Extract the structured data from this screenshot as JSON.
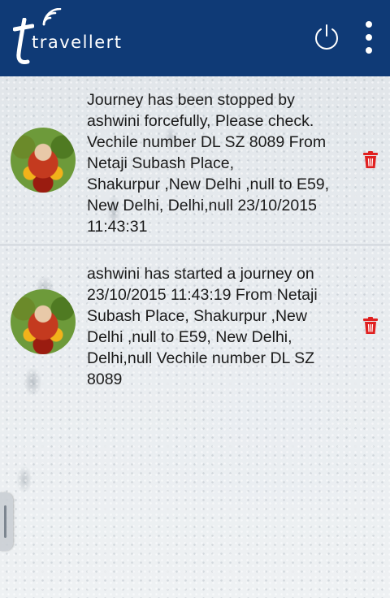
{
  "app": {
    "title": "travellert",
    "logo_icon": "travellert-logo-icon",
    "accent_color": "#0f3a76"
  },
  "toolbar": {
    "power_icon": "power-icon",
    "overflow_icon": "more-vertical-icon"
  },
  "notifications": [
    {
      "message": "Journey has been stopped by\nashwini forcefully, Please check.\nVechile number DL SZ 8089 From\nNetaji Subash Place,\nShakurpur ,New Delhi ,null to E59,\nNew Delhi, Delhi,null 23/10/2015\n11:43:31",
      "avatar_icon": "profile-avatar",
      "delete_icon": "trash-icon",
      "delete_color": "#e02020"
    },
    {
      "message": "ashwini has started a journey on\n23/10/2015 11:43:19 From Netaji\nSubash Place, Shakurpur ,New\nDelhi ,null to E59, New Delhi,\nDelhi,null Vechile number DL SZ\n8089",
      "avatar_icon": "profile-avatar",
      "delete_icon": "trash-icon",
      "delete_color": "#e02020"
    }
  ]
}
